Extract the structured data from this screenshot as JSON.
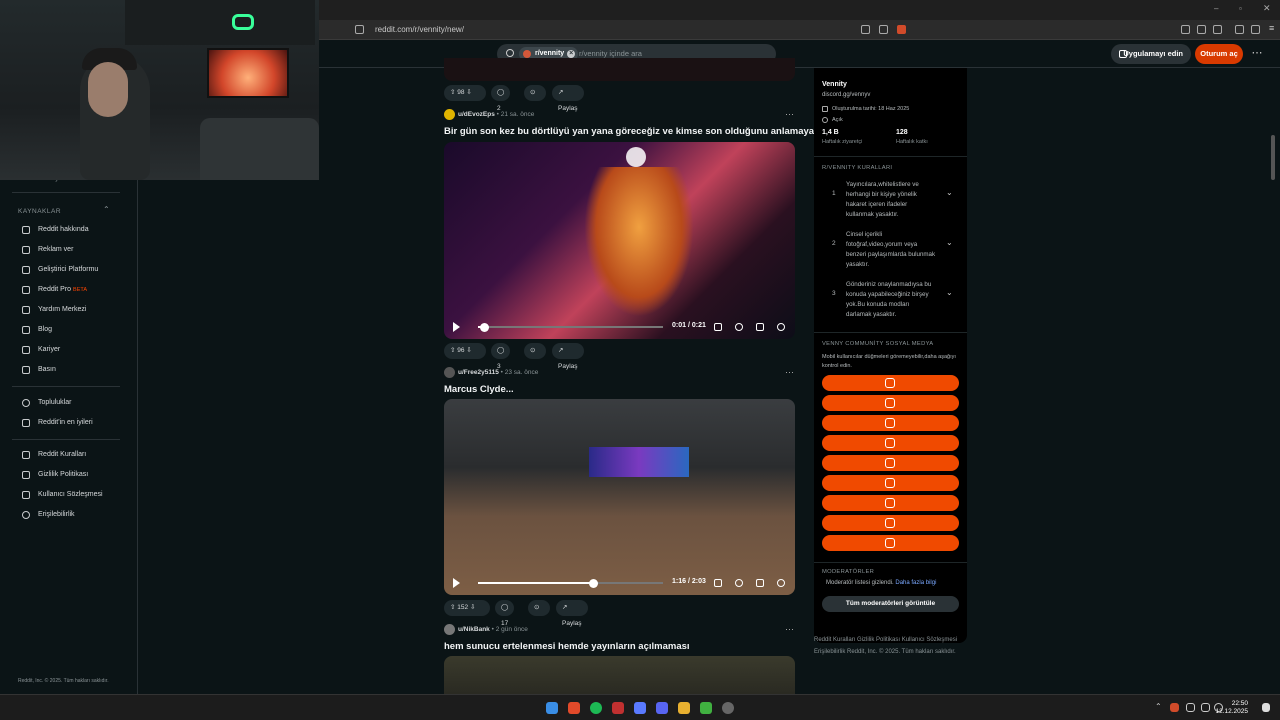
{
  "browser": {
    "url": "reddit.com/r/vennity/new/"
  },
  "header": {
    "search_chip": "r/vennity",
    "search_placeholder": "r/vennity içinde ara",
    "app_button": "Uygulamayı edin",
    "login_button": "Oturum aç"
  },
  "sidebar": {
    "partial_item": "r/vennity",
    "resources_heading": "KAYNAKLAR",
    "items": [
      "Reddit hakkında",
      "Reklam ver",
      "Geliştirici Platformu",
      "Reddit Pro",
      "Yardım Merkezi",
      "Blog",
      "Kariyer",
      "Basın"
    ],
    "beta": "BETA",
    "items2": [
      "Topluluklar",
      "Reddit'in en iyileri"
    ],
    "items3": [
      "Reddit Kuralları",
      "Gizlilik Politikası",
      "Kullanıcı Sözleşmesi",
      "Erişilebilirlik"
    ],
    "footer": "Reddit, Inc. © 2025. Tüm hakları saklıdır."
  },
  "posts": [
    {
      "upvotes": "98",
      "comments": "2",
      "share": "Paylaş"
    },
    {
      "author": "u/dEvozEps",
      "time": "• 21 sa. önce",
      "title": "Bir gün son kez bu dörtlüyü yan yana göreceğiz ve kimse son olduğunu anlamayacak",
      "video_time": "0:01 / 0:21",
      "progress": 0.03,
      "upvotes": "96",
      "comments": "3",
      "share": "Paylaş"
    },
    {
      "author": "u/Free2y5115",
      "time": "• 23 sa. önce",
      "title": "Marcus Clyde...",
      "video_time": "1:16 / 2:03",
      "progress": 0.62,
      "upvotes": "152",
      "comments": "17",
      "share": "Paylaş"
    },
    {
      "author": "u/NikBank",
      "time": "• 2 gün önce",
      "title": "hem sunucu ertelenmesi hemde yayınların açılmaması"
    }
  ],
  "community": {
    "name": "Vennity",
    "link": "discord.gg/vennyv",
    "created": "Oluşturulma tarihi: 18 Haz 2025",
    "visibility": "Açık",
    "weekly_visitors": "1,4 B",
    "weekly_visitors_label": "Haftalık ziyaretçi",
    "weekly_contrib": "128",
    "weekly_contrib_label": "Haftalık katkı",
    "rules_heading": "R/VENNITY KURALLARI",
    "rules": [
      {
        "n": "1",
        "text": "Yayıncılara,whitelistlere ve herhangi bir kişiye yönelik hakaret içeren ifadeler kullanmak yasaktır."
      },
      {
        "n": "2",
        "text": "Cinsel içerikli fotoğraf,video,yorum veya benzeri paylaşımlarda bulunmak yasaktır."
      },
      {
        "n": "3",
        "text": "Gönderiniz onaylanmadıysa bu konuda yapabileceğiniz birşey yok.Bu konuda modları darlamak yasaktır."
      }
    ],
    "social_heading": "VENNY COMMUNİTY SOSYAL MEDYA",
    "social_desc": "Mobil kullanıcılar düğmeleri göremeyebilir,daha aşağıyı kontrol edin.",
    "social_icons": [
      "globe-icon",
      "discord-icon",
      "youtube-icon",
      "instagram-icon",
      "x-icon",
      "twitch-icon",
      "kick-icon",
      "tiktok-icon",
      "steam-icon"
    ],
    "mods_heading": "MODERATÖRLER",
    "mods_hidden": "Moderatör listesi gizlendi.",
    "mods_more": "Daha fazla bilgi",
    "mods_button": "Tüm moderatörleri görüntüle"
  },
  "footer_links": {
    "line1": "Reddit Kuralları   Gizlilik Politikası   Kullanıcı Sözleşmesi",
    "line2": "Erişilebilirlik   Reddit, Inc. © 2025. Tüm hakları saklıdır."
  },
  "clock": {
    "time": "22:50",
    "date": "12.12.2025"
  },
  "colors": {
    "accent": "#d93a00",
    "social": "#f04a00",
    "bg": "#0b1416"
  }
}
